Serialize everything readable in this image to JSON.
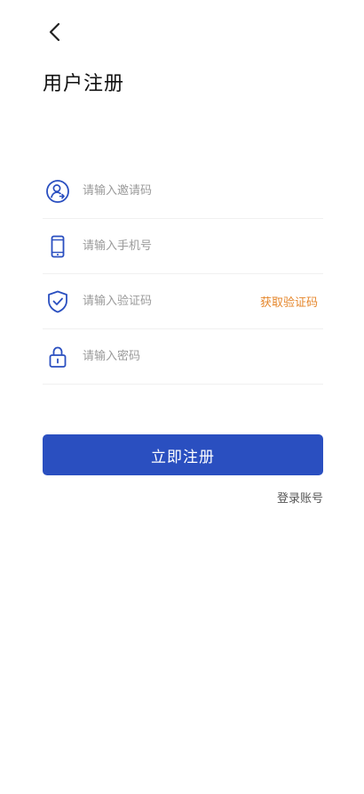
{
  "header": {
    "back_icon": "chevron-left-icon",
    "title": "用户注册"
  },
  "form": {
    "invite_code": {
      "icon": "user-circle-icon",
      "placeholder": "请输入邀请码",
      "value": ""
    },
    "phone": {
      "icon": "smartphone-icon",
      "placeholder": "请输入手机号",
      "value": ""
    },
    "verify_code": {
      "icon": "shield-check-icon",
      "placeholder": "请输入验证码",
      "value": "",
      "get_code_label": "获取验证码"
    },
    "password": {
      "icon": "lock-icon",
      "placeholder": "请输入密码",
      "value": ""
    }
  },
  "actions": {
    "submit_label": "立即注册",
    "login_label": "登录账号"
  },
  "colors": {
    "primary": "#2a4fc0",
    "accent": "#e5862b",
    "icon": "#2a4fc0"
  }
}
